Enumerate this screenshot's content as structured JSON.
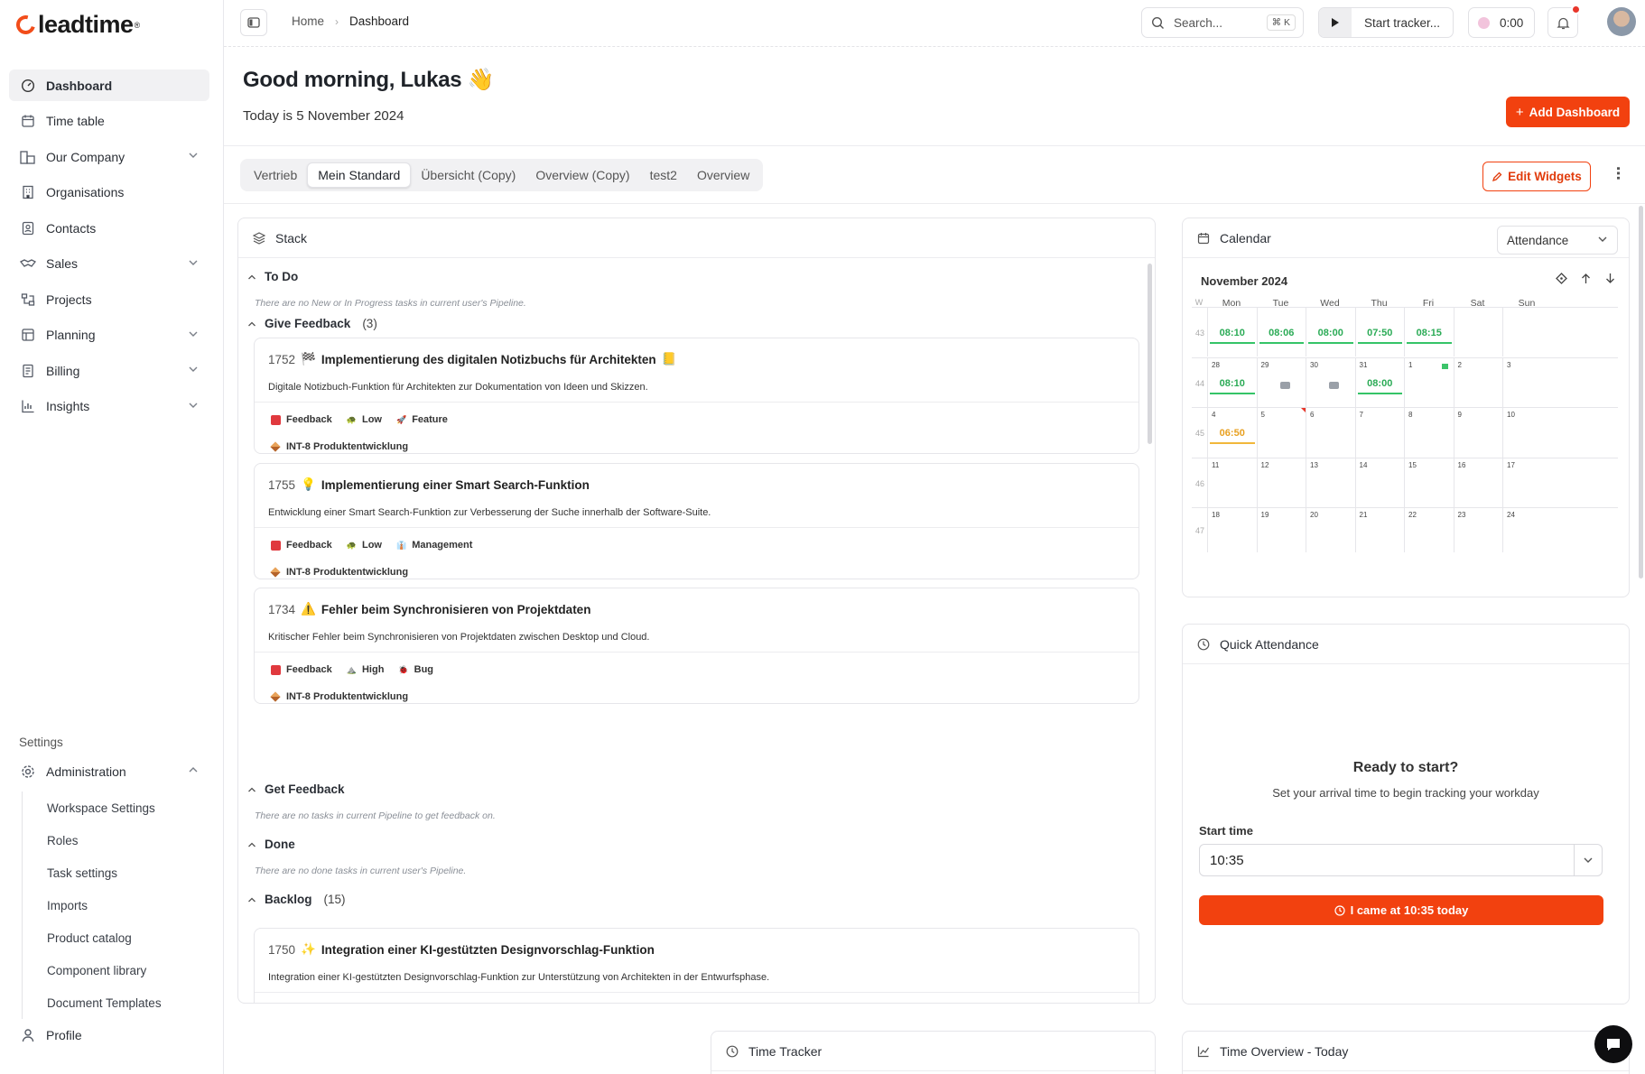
{
  "brand": {
    "name": "leadtime",
    "mark": "®"
  },
  "sidebar": {
    "items": [
      {
        "label": "Dashboard",
        "icon": "dashboard-gauge-icon",
        "active": true,
        "chevron": false
      },
      {
        "label": "Time table",
        "icon": "calendar-icon",
        "chevron": false
      },
      {
        "label": "Our Company",
        "icon": "company-icon",
        "chevron": true
      },
      {
        "label": "Organisations",
        "icon": "building-icon",
        "chevron": false
      },
      {
        "label": "Contacts",
        "icon": "contacts-icon",
        "chevron": false
      },
      {
        "label": "Sales",
        "icon": "handshake-icon",
        "chevron": true
      },
      {
        "label": "Projects",
        "icon": "projects-icon",
        "chevron": false
      },
      {
        "label": "Planning",
        "icon": "planning-icon",
        "chevron": true
      },
      {
        "label": "Billing",
        "icon": "billing-icon",
        "chevron": true
      },
      {
        "label": "Insights",
        "icon": "chart-icon",
        "chevron": true
      }
    ],
    "settings_label": "Settings",
    "administration": "Administration",
    "admin_items": [
      "Workspace Settings",
      "Roles",
      "Task settings",
      "Imports",
      "Product catalog",
      "Component library",
      "Document Templates"
    ],
    "profile": "Profile"
  },
  "topbar": {
    "breadcrumb": [
      "Home",
      "Dashboard"
    ],
    "search_placeholder": "Search...",
    "search_shortcut": "⌘ K",
    "tracker_label": "Start tracker...",
    "timer": "0:00"
  },
  "header": {
    "greeting": "Good morning, Lukas 👋",
    "date_line": "Today is 5 November 2024",
    "add_dashboard": "Add Dashboard",
    "edit_widgets": "Edit Widgets"
  },
  "tabs": [
    "Vertrieb",
    "Mein Standard",
    "Übersicht (Copy)",
    "Overview (Copy)",
    "test2",
    "Overview"
  ],
  "active_tab": "Mein Standard",
  "stack": {
    "title": "Stack",
    "todo": {
      "label": "To Do",
      "empty": "There are no New or In Progress tasks in current user's Pipeline."
    },
    "give_feedback": {
      "label": "Give Feedback",
      "count": "(3)"
    },
    "tasks": [
      {
        "id": "1752",
        "emoji": "🏁",
        "title": "Implementierung des digitalen Notizbuchs für Architekten",
        "emoji_end": "📒",
        "desc": "Digitale Notizbuch-Funktion für Architekten zur Dokumentation von Ideen und Skizzen.",
        "status": "Feedback",
        "priority": "Low",
        "type": "Feature",
        "type_icon": "🚀",
        "priority_icon": "🐢",
        "project": "INT-8 Produktentwicklung"
      },
      {
        "id": "1755",
        "emoji": "💡",
        "title": "Implementierung einer Smart Search-Funktion",
        "emoji_end": "",
        "desc": "Entwicklung einer Smart Search-Funktion zur Verbesserung der Suche innerhalb der Software-Suite.",
        "status": "Feedback",
        "priority": "Low",
        "type": "Management",
        "type_icon": "👔",
        "priority_icon": "🐢",
        "project": "INT-8 Produktentwicklung"
      },
      {
        "id": "1734",
        "emoji": "⚠️",
        "title": "Fehler beim Synchronisieren von Projektdaten",
        "emoji_end": "",
        "desc": "Kritischer Fehler beim Synchronisieren von Projektdaten zwischen Desktop und Cloud.",
        "status": "Feedback",
        "priority": "High",
        "type": "Bug",
        "type_icon": "🐞",
        "priority_icon": "⛰️",
        "project": "INT-8 Produktentwicklung"
      }
    ],
    "get_feedback": {
      "label": "Get Feedback",
      "empty": "There are no tasks in current Pipeline to get feedback on."
    },
    "done": {
      "label": "Done",
      "empty": "There are no done tasks in current user's Pipeline."
    },
    "backlog": {
      "label": "Backlog",
      "count": "(15)"
    },
    "backlog_task": {
      "id": "1750",
      "emoji": "✨",
      "title": "Integration einer KI-gestützten Designvorschlag-Funktion",
      "desc": "Integration einer KI-gestützten Designvorschlag-Funktion zur Unterstützung von Architekten in der Entwurfsphase."
    }
  },
  "calendar": {
    "title": "Calendar",
    "mode": "Attendance",
    "month": "November 2024",
    "week_col": "W",
    "days": [
      "Mon",
      "Tue",
      "Wed",
      "Thu",
      "Fri",
      "Sat",
      "Sun"
    ],
    "weeks": [
      {
        "wk": "43",
        "dates": [
          "",
          "",
          "",
          "",
          "",
          "",
          ""
        ],
        "times": [
          "08:10",
          "08:06",
          "08:00",
          "07:50",
          "08:15",
          "",
          ""
        ]
      },
      {
        "wk": "44",
        "dates": [
          "28",
          "29",
          "30",
          "31",
          "1",
          "2",
          "3"
        ],
        "times": [
          "08:10",
          "",
          "",
          "08:00",
          "",
          "",
          ""
        ]
      },
      {
        "wk": "45",
        "dates": [
          "4",
          "5",
          "6",
          "7",
          "8",
          "9",
          "10"
        ],
        "times": [
          "06:50",
          "",
          "",
          "",
          "",
          "",
          ""
        ]
      },
      {
        "wk": "46",
        "dates": [
          "11",
          "12",
          "13",
          "14",
          "15",
          "16",
          "17"
        ],
        "times": [
          "",
          "",
          "",
          "",
          "",
          "",
          ""
        ]
      },
      {
        "wk": "47",
        "dates": [
          "18",
          "19",
          "20",
          "21",
          "22",
          "23",
          "24"
        ],
        "times": [
          "",
          "",
          "",
          "",
          "",
          "",
          ""
        ]
      }
    ]
  },
  "quick": {
    "title": "Quick Attendance",
    "heading": "Ready to start?",
    "sub": "Set your arrival time to begin tracking your workday",
    "start_label": "Start time",
    "start_value": "10:35",
    "button": "I came at 10:35 today"
  },
  "bottom": {
    "time_tracker": "Time Tracker",
    "time_overview": "Time Overview - Today"
  },
  "colors": {
    "accent": "#f2410f",
    "green": "#2bab56",
    "amber": "#e8a020",
    "feedback": "#e0393e"
  }
}
